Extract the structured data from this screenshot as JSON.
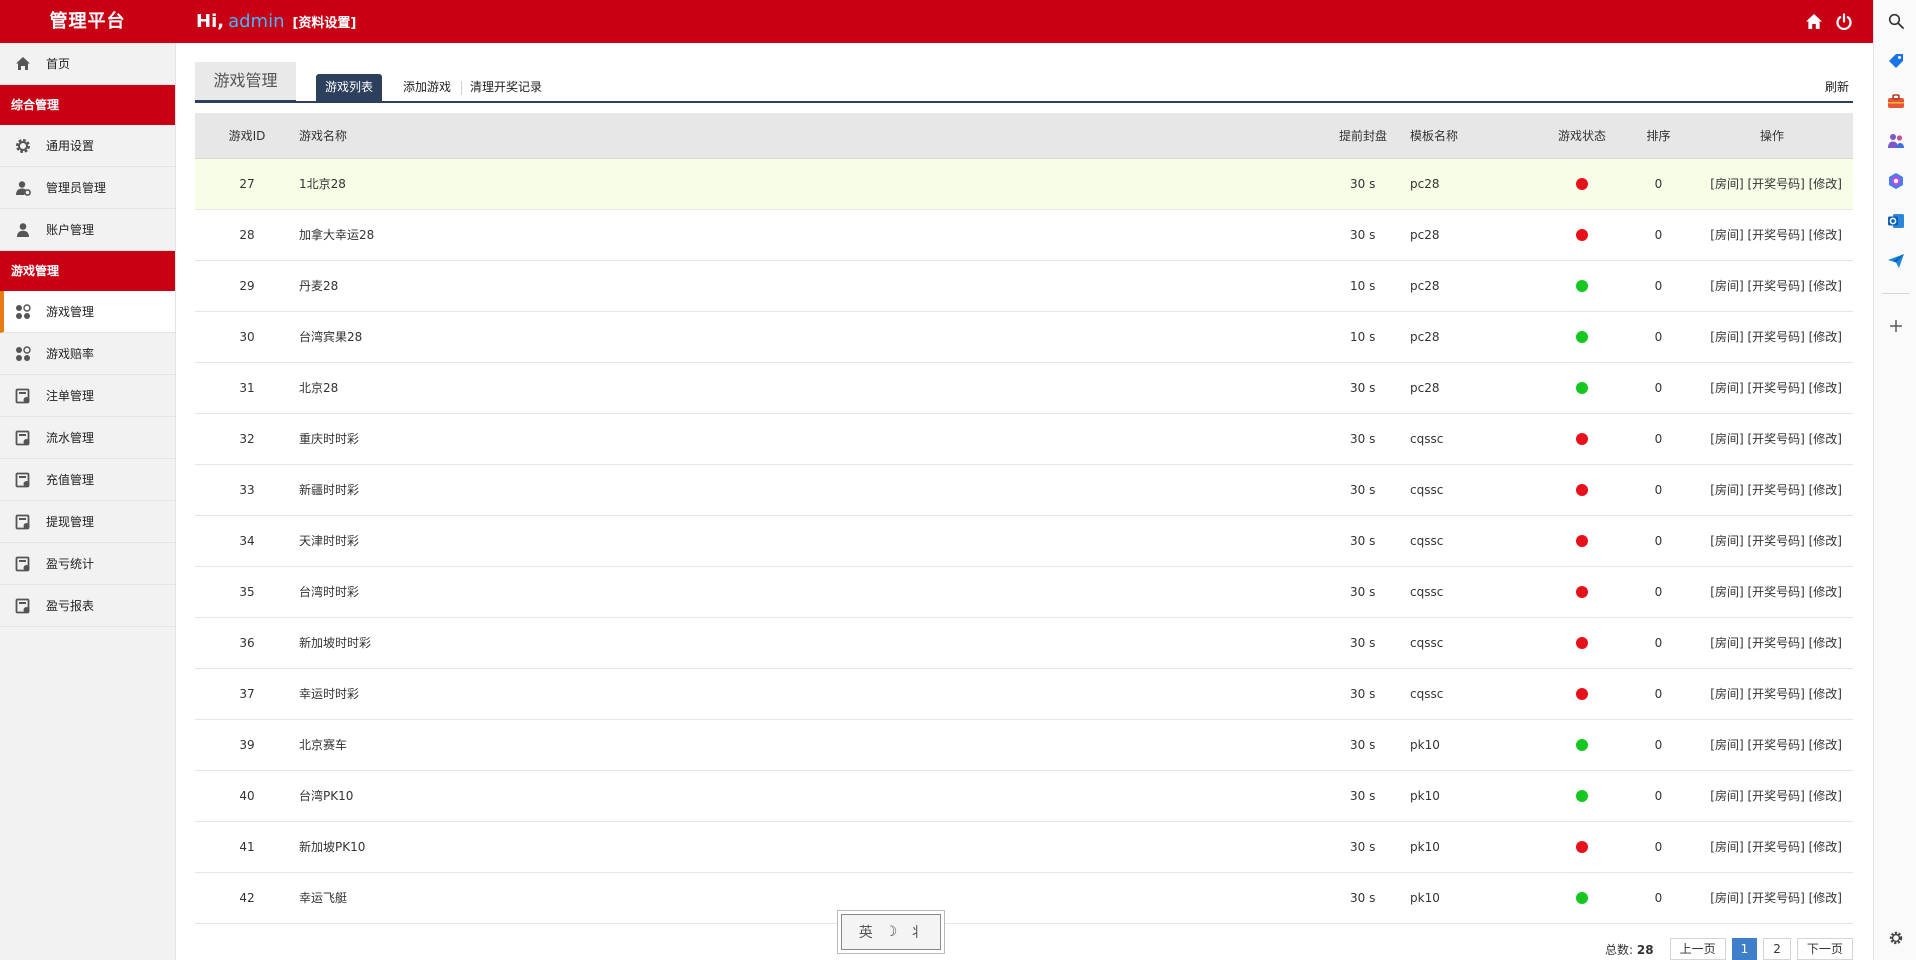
{
  "header": {
    "brand": "管理平台",
    "greeting": "Hi,",
    "username": "admin",
    "settings_link": "[资料设置]"
  },
  "sidebar": {
    "home": "首页",
    "group1": "综合管理",
    "group1_items": [
      "通用设置",
      "管理员管理",
      "账户管理"
    ],
    "group2": "游戏管理",
    "group2_items": [
      "游戏管理",
      "游戏赔率",
      "注单管理",
      "流水管理",
      "充值管理",
      "提现管理",
      "盈亏统计",
      "盈亏报表"
    ]
  },
  "tabs": {
    "main": "游戏管理",
    "sub": [
      "游戏列表",
      "添加游戏",
      "清理开奖记录"
    ],
    "refresh": "刷新"
  },
  "table": {
    "headers": [
      "游戏ID",
      "游戏名称",
      "提前封盘",
      "模板名称",
      "游戏状态",
      "排序",
      "操作"
    ],
    "ops": "[房间] [开奖号码] [修改]",
    "rows": [
      {
        "id": "27",
        "name": "1北京28",
        "close": "30 s",
        "tpl": "pc28",
        "status": "red",
        "order": "0"
      },
      {
        "id": "28",
        "name": "加拿大幸运28",
        "close": "30 s",
        "tpl": "pc28",
        "status": "red",
        "order": "0"
      },
      {
        "id": "29",
        "name": "丹麦28",
        "close": "10 s",
        "tpl": "pc28",
        "status": "green",
        "order": "0"
      },
      {
        "id": "30",
        "name": "台湾宾果28",
        "close": "10 s",
        "tpl": "pc28",
        "status": "green",
        "order": "0"
      },
      {
        "id": "31",
        "name": "北京28",
        "close": "30 s",
        "tpl": "pc28",
        "status": "green",
        "order": "0"
      },
      {
        "id": "32",
        "name": "重庆时时彩",
        "close": "30 s",
        "tpl": "cqssc",
        "status": "red",
        "order": "0"
      },
      {
        "id": "33",
        "name": "新疆时时彩",
        "close": "30 s",
        "tpl": "cqssc",
        "status": "red",
        "order": "0"
      },
      {
        "id": "34",
        "name": "天津时时彩",
        "close": "30 s",
        "tpl": "cqssc",
        "status": "red",
        "order": "0"
      },
      {
        "id": "35",
        "name": "台湾时时彩",
        "close": "30 s",
        "tpl": "cqssc",
        "status": "red",
        "order": "0"
      },
      {
        "id": "36",
        "name": "新加坡时时彩",
        "close": "30 s",
        "tpl": "cqssc",
        "status": "red",
        "order": "0"
      },
      {
        "id": "37",
        "name": "幸运时时彩",
        "close": "30 s",
        "tpl": "cqssc",
        "status": "red",
        "order": "0"
      },
      {
        "id": "39",
        "name": "北京赛车",
        "close": "30 s",
        "tpl": "pk10",
        "status": "green",
        "order": "0"
      },
      {
        "id": "40",
        "name": "台湾PK10",
        "close": "30 s",
        "tpl": "pk10",
        "status": "green",
        "order": "0"
      },
      {
        "id": "41",
        "name": "新加坡PK10",
        "close": "30 s",
        "tpl": "pk10",
        "status": "red",
        "order": "0"
      },
      {
        "id": "42",
        "name": "幸运飞艇",
        "close": "30 s",
        "tpl": "pk10",
        "status": "green",
        "order": "0"
      }
    ]
  },
  "pager": {
    "total_label": "总数:",
    "total": "28",
    "prev": "上一页",
    "pages": [
      "1",
      "2"
    ],
    "next": "下一页"
  },
  "ime": {
    "mode": "英",
    "moon": "☽",
    "extra": "⺦"
  },
  "colors": {
    "brand_red": "#c90013",
    "navy": "#2c3f5c",
    "status_red": "#e8101a",
    "status_green": "#14c81f",
    "highlight_row": "#f8fde8",
    "active_page": "#3f7ec9"
  },
  "icons": {
    "top": [
      "home-icon",
      "power-icon"
    ],
    "dock": [
      "search-icon",
      "tag-icon",
      "toolbox-icon",
      "people-icon",
      "copilot-icon",
      "outlook-icon",
      "send-icon",
      "plus-icon",
      "settings-icon"
    ]
  }
}
